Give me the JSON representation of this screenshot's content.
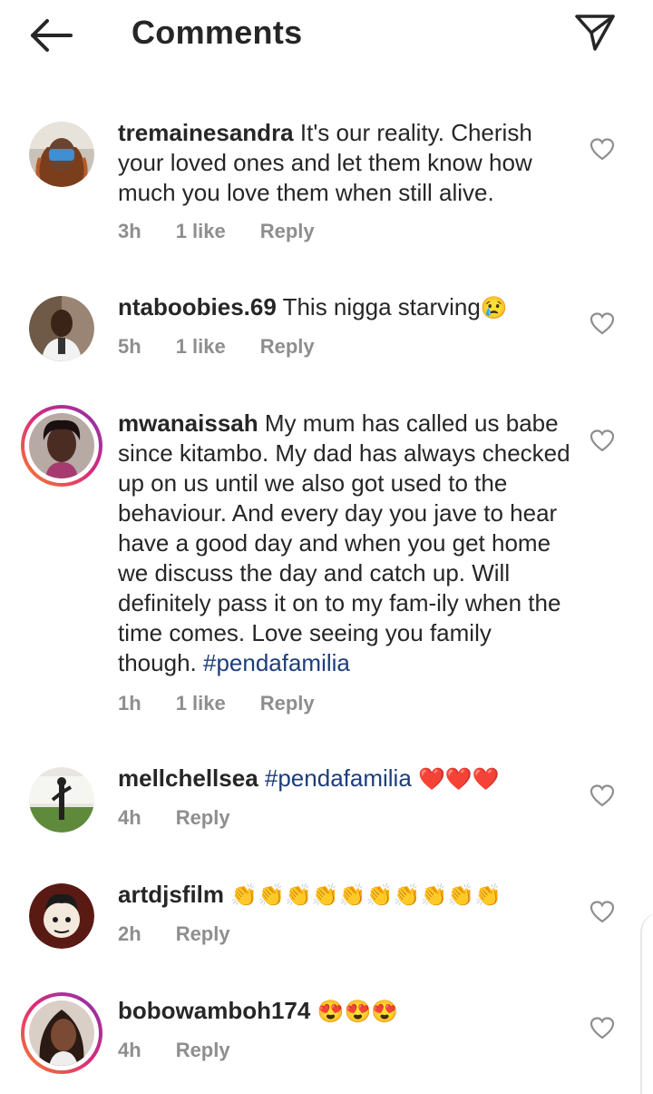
{
  "header": {
    "title": "Comments",
    "back_icon": "arrow-left-icon",
    "share_icon": "send-icon"
  },
  "comments": [
    {
      "username": "tremainesandra",
      "text": "It's our reality. Cherish your loved ones and let them know how much you love them when still alive.",
      "time": "3h",
      "likes": "1 like",
      "reply": "Reply"
    },
    {
      "username": "ntaboobies.69",
      "text": "This nigga starving",
      "emoji": "😢",
      "time": "5h",
      "likes": "1 like",
      "reply": "Reply"
    },
    {
      "username": "mwanaissah",
      "text": "My mum has called us babe since kitambo. My dad has always checked up on us until we also got used to the behaviour. And every day you jave to hear have a good day and when you get home we discuss the day and catch up. Will definitely pass it on to my fam-ily when the time comes. Love seeing you family though.",
      "hashtag": "#pendafamilia",
      "time": "1h",
      "likes": "1 like",
      "reply": "Reply"
    },
    {
      "username": "mellchellsea",
      "hashtag": "#pendafamilia",
      "emoji": "❤️❤️❤️",
      "time": "4h",
      "reply": "Reply"
    },
    {
      "username": "artdjsfilm",
      "emoji": "👏👏👏👏👏👏👏👏👏👏",
      "time": "2h",
      "reply": "Reply"
    },
    {
      "username": "bobowamboh174",
      "emoji": "😍😍😍",
      "time": "4h",
      "reply": "Reply"
    }
  ],
  "colors": {
    "text": "#262626",
    "meta": "#8e8e8e",
    "hashtag": "#1c3d7a"
  }
}
